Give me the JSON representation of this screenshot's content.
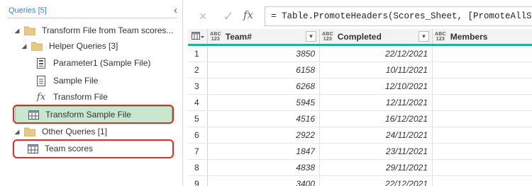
{
  "queries_pane": {
    "title": "Queries [5]",
    "collapse_icon": "chevron-left-icon",
    "items": [
      {
        "label": "Transform File from Team scores...",
        "icon": "folder-icon",
        "expanded": true
      },
      {
        "label": "Helper Queries [3]",
        "icon": "folder-icon",
        "expanded": true
      },
      {
        "label": "Parameter1 (Sample File)",
        "icon": "parameter-icon"
      },
      {
        "label": "Sample File",
        "icon": "document-icon"
      },
      {
        "label": "Transform File",
        "icon": "function-icon"
      },
      {
        "label": "Transform Sample File",
        "icon": "table-icon",
        "selected": true,
        "highlighted": true
      },
      {
        "label": "Other Queries [1]",
        "icon": "folder-icon",
        "expanded": true
      },
      {
        "label": "Team scores",
        "icon": "table-icon",
        "highlighted": true
      }
    ]
  },
  "formula_bar": {
    "cancel_icon": "×",
    "confirm_icon": "✓",
    "fx_label": "fx",
    "formula": "= Table.PromoteHeaders(Scores_Sheet, [PromoteAllScalars"
  },
  "grid": {
    "type_label_top": "ABC",
    "type_label_bottom": "123",
    "columns": [
      "Team#",
      "Completed",
      "Members"
    ],
    "rows": [
      {
        "num": "1",
        "team": "3850",
        "completed": "22/12/2021"
      },
      {
        "num": "2",
        "team": "6158",
        "completed": "10/11/2021"
      },
      {
        "num": "3",
        "team": "6268",
        "completed": "12/10/2021"
      },
      {
        "num": "4",
        "team": "5945",
        "completed": "12/11/2021"
      },
      {
        "num": "5",
        "team": "4516",
        "completed": "16/12/2021"
      },
      {
        "num": "6",
        "team": "2922",
        "completed": "24/11/2021"
      },
      {
        "num": "7",
        "team": "1847",
        "completed": "23/11/2021"
      },
      {
        "num": "8",
        "team": "4838",
        "completed": "29/11/2021"
      },
      {
        "num": "9",
        "team": "3400",
        "completed": "22/12/2021"
      }
    ]
  },
  "colors": {
    "accent_teal": "#20b0a0",
    "selection_green": "#c9e6cf",
    "highlight_red": "#e02b2b",
    "header_blue": "#3f80c4"
  }
}
